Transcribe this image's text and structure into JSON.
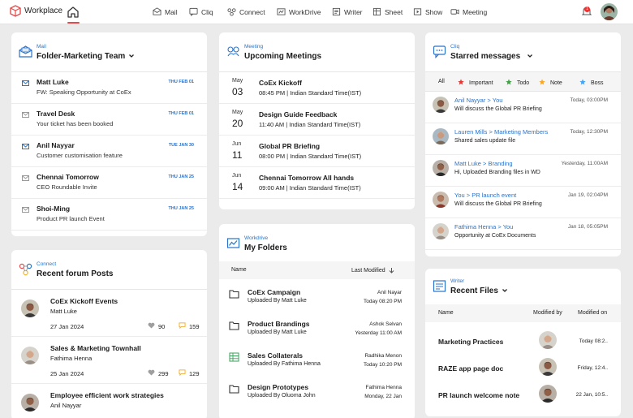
{
  "app": {
    "title": "Workplace"
  },
  "nav": [
    {
      "label": "Mail",
      "icon": "mail-icon"
    },
    {
      "label": "Cliq",
      "icon": "cliq-icon"
    },
    {
      "label": "Connect",
      "icon": "connect-icon"
    },
    {
      "label": "WorkDrive",
      "icon": "workdrive-icon"
    },
    {
      "label": "Writer",
      "icon": "writer-icon"
    },
    {
      "label": "Sheet",
      "icon": "sheet-icon"
    },
    {
      "label": "Show",
      "icon": "show-icon"
    },
    {
      "label": "Meeting",
      "icon": "meeting-icon"
    }
  ],
  "notifications": {
    "count": "1"
  },
  "colors": {
    "accent": "#2a73c9",
    "brand": "#e64b4b"
  },
  "mail": {
    "app": "Mail",
    "title": "Folder-Marketing Team",
    "items": [
      {
        "from": "Matt Luke",
        "subject": "FW: Speaking Opportunity at CoEx",
        "date": "THU FEB 01",
        "unread": true
      },
      {
        "from": "Travel Desk",
        "subject": "Your ticket has been booked",
        "date": "THU FEB 01",
        "unread": false
      },
      {
        "from": "Anil Nayyar",
        "subject": "Customer customisation feature",
        "date": "TUE JAN 30",
        "unread": true
      },
      {
        "from": "Chennai Tomorrow",
        "subject": "CEO Roundable Invite",
        "date": "THU JAN 25",
        "unread": false
      },
      {
        "from": "Shoi-Ming",
        "subject": "Product PR launch Event",
        "date": "THU JAN 25",
        "unread": false
      }
    ]
  },
  "meeting": {
    "app": "Meeting",
    "title": "Upcoming Meetings",
    "items": [
      {
        "month": "May",
        "day": "03",
        "title": "CoEx Kickoff",
        "time": "08:45 PM | Indian Standard Time(IST)"
      },
      {
        "month": "May",
        "day": "20",
        "title": "Design Guide Feedback",
        "time": "11:40 AM | Indian Standard Time(IST)"
      },
      {
        "month": "Jun",
        "day": "11",
        "title": "Global PR Briefing",
        "time": "08:00 PM | Indian Standard Time(IST)"
      },
      {
        "month": "Jun",
        "day": "14",
        "title": "Chennai Tomorrow All hands",
        "time": "09:00 AM | Indian Standard Time(IST)"
      }
    ]
  },
  "cliq": {
    "app": "Cliq",
    "title": "Starred messages",
    "tabs": [
      {
        "label": "All",
        "star": ""
      },
      {
        "label": "Important",
        "star": "#e53935"
      },
      {
        "label": "Todo",
        "star": "#43a047"
      },
      {
        "label": "Note",
        "star": "#f9a825"
      },
      {
        "label": "Boss",
        "star": "#42a5f5"
      }
    ],
    "messages": [
      {
        "name": "Anil Nayyar > You",
        "text": "Will discuss the Global PR Briefing",
        "time": "Today, 03:00PM"
      },
      {
        "name": "Lauren Mills > Marketing Members",
        "text": "Shared sales update file",
        "time": "Today, 12:30PM"
      },
      {
        "name": "Matt Luke > Branding",
        "text": "Hi, Uploaded Branding files in WD",
        "time": "Yesterday, 11:00AM"
      },
      {
        "name": "You > PR launch event",
        "text": "Will discuss the Global PR Briefing",
        "time": "Jan 19, 02:04PM"
      },
      {
        "name": "Fathima Henna > You",
        "text": "Opportunity at CoEx Documents",
        "time": "Jan 18, 05:05PM"
      }
    ]
  },
  "connect": {
    "app": "Connect",
    "title": "Recent forum Posts",
    "posts": [
      {
        "title": "CoEx Kickoff Events",
        "author": "Matt Luke",
        "date": "27 Jan 2024",
        "likes": "90",
        "comments": "159"
      },
      {
        "title": "Sales & Marketing Townhall",
        "author": "Fathima Henna",
        "date": "25 Jan 2024",
        "likes": "299",
        "comments": "129"
      },
      {
        "title": "Employee efficient work strategies",
        "author": "Anil Nayyar",
        "date": "",
        "likes": "",
        "comments": ""
      }
    ]
  },
  "workdrive": {
    "app": "Workdrive",
    "title": "My Folders",
    "col_name": "Name",
    "col_modified": "Last Modified",
    "items": [
      {
        "name": "CoEx Campaign",
        "uploaded": "Uploaded By Matt Luke",
        "owner": "Anil Nayar",
        "modified": "Today 08:20 PM",
        "icon": "folder-icon"
      },
      {
        "name": "Product Brandings",
        "uploaded": "Uploaded By Matt Luke",
        "owner": "Ashok Selvan",
        "modified": "Yesterday 11:00 AM",
        "icon": "folder-icon"
      },
      {
        "name": "Sales Collaterals",
        "uploaded": "Uploaded By Fathima Henna",
        "owner": "Radhika Menon",
        "modified": "Today 10:20 PM",
        "icon": "spreadsheet-icon"
      },
      {
        "name": "Design Prototypes",
        "uploaded": "Uploaded By Oluoma John",
        "owner": "Fathima Henna",
        "modified": "Monday, 22 Jan",
        "icon": "folder-icon"
      }
    ]
  },
  "writer": {
    "app": "Writer",
    "title": "Recent Files",
    "col_name": "Name",
    "col_by": "Modified by",
    "col_on": "Modified on",
    "files": [
      {
        "name": "Marketing Practices",
        "date": "Today 08:2.."
      },
      {
        "name": "RAZE app page doc",
        "date": "Friday, 12:4.."
      },
      {
        "name": "PR launch welcome note",
        "date": "22 Jan, 10:5.."
      }
    ]
  }
}
